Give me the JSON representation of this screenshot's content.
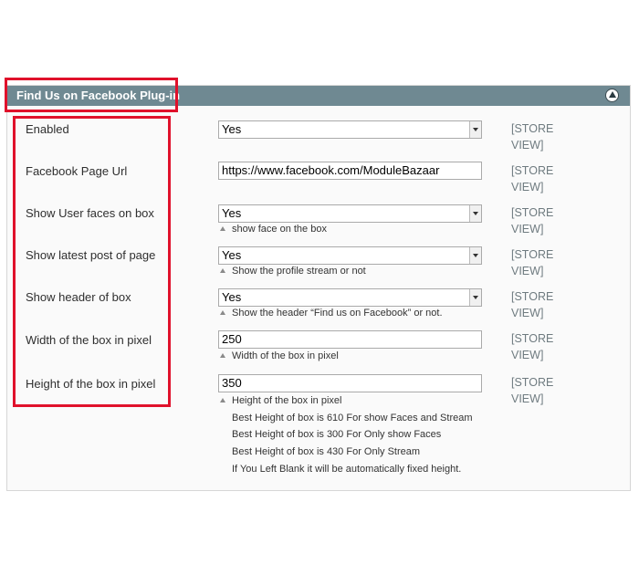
{
  "section": {
    "title": "Find Us on Facebook Plug-in",
    "collapse_icon": "chevron-up-icon",
    "header_color": "#6f8992"
  },
  "highlight_color": "#e0112b",
  "fields": [
    {
      "label": "Enabled",
      "type": "select",
      "value": "Yes",
      "scope": "[STORE VIEW]",
      "note": ""
    },
    {
      "label": "Facebook Page Url",
      "type": "text",
      "value": "https://www.facebook.com/ModuleBazaar",
      "scope": "[STORE VIEW]",
      "note": ""
    },
    {
      "label": "Show User faces on box",
      "type": "select",
      "value": "Yes",
      "scope": "[STORE VIEW]",
      "note": "show face on the box"
    },
    {
      "label": "Show latest post of page",
      "type": "select",
      "value": "Yes",
      "scope": "[STORE VIEW]",
      "note": "Show the profile stream or not"
    },
    {
      "label": "Show header of box",
      "type": "select",
      "value": "Yes",
      "scope": "[STORE VIEW]",
      "note": "Show the header “Find us on Facebook” or not."
    },
    {
      "label": "Width of the box in pixel",
      "type": "text",
      "value": "250",
      "scope": "[STORE VIEW]",
      "note": "Width of the box in pixel"
    },
    {
      "label": "Height of the box in pixel",
      "type": "text",
      "value": "350",
      "scope": "[STORE VIEW]",
      "note": "Height of the box in pixel"
    }
  ],
  "height_notes": [
    "Best Height of box is 610 For show Faces and Stream",
    "Best Height of box is 300 For Only show Faces",
    "Best Height of box is 430 For Only Stream",
    "If You Left Blank it will be automatically fixed height."
  ]
}
